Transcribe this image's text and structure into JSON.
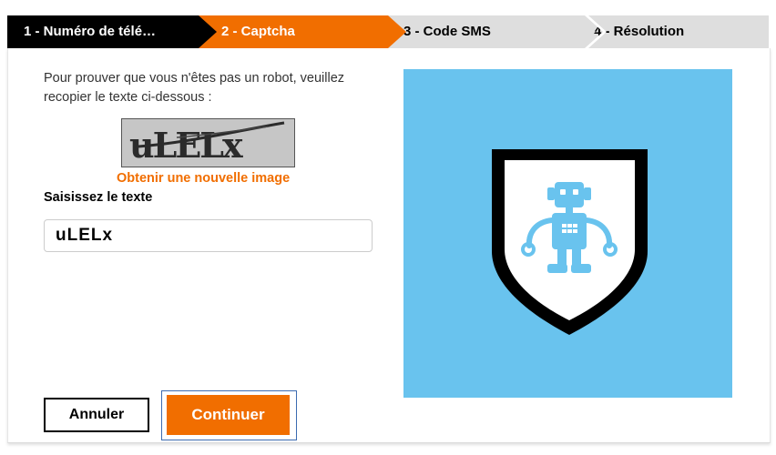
{
  "stepper": {
    "steps": [
      {
        "label": "1 - Numéro de télé…",
        "state": "completed"
      },
      {
        "label": "2 - Captcha",
        "state": "active"
      },
      {
        "label": "3 - Code SMS",
        "state": "pending"
      },
      {
        "label": "4 - Résolution",
        "state": "pending"
      }
    ]
  },
  "form": {
    "instructions": "Pour prouver que vous n'êtes pas un robot, veuillez recopier le texte ci-dessous :",
    "captcha_text": "uLELx",
    "new_image_link": "Obtenir une nouvelle image",
    "field_label": "Saisissez le texte",
    "input_value": "uLELx"
  },
  "buttons": {
    "cancel": "Annuler",
    "continue": "Continuer"
  },
  "illustration": {
    "icon": "robot-shield-icon",
    "background": "#69c3ee"
  },
  "colors": {
    "accent": "#f16e00",
    "step_completed": "#000000",
    "step_pending": "#dedede",
    "focus_outline": "#3c6bb0"
  }
}
